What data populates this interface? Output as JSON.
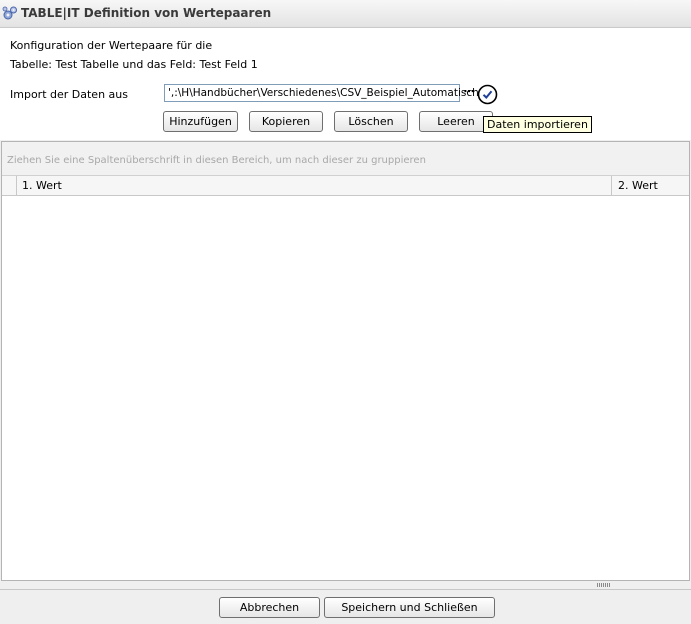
{
  "window": {
    "title": "TABLE|IT Definition von Wertepaaren",
    "icon": "gears-icon"
  },
  "config": {
    "line1": "Konfiguration der Wertepaare für die",
    "line2": "Tabelle: Test Tabelle und das Feld: Test Feld 1",
    "import_label": "Import der Daten aus",
    "import_path": "',:\\H\\Handbücher\\Verschiedenes\\CSV_Beispiel_Automatische:",
    "browse_label": "⋯",
    "import_icon": "check-circle-icon"
  },
  "toolbar": {
    "add": "Hinzufügen",
    "copy": "Kopieren",
    "delete": "Löschen",
    "clear": "Leeren"
  },
  "tooltip": {
    "text": "Daten importieren"
  },
  "grid": {
    "group_hint": "Ziehen Sie eine Spaltenüberschrift in diesen Bereich, um nach dieser zu gruppieren",
    "columns": [
      "1. Wert",
      "2. Wert"
    ],
    "rows": []
  },
  "footer": {
    "cancel": "Abbrechen",
    "save_close": "Speichern und Schließen"
  }
}
